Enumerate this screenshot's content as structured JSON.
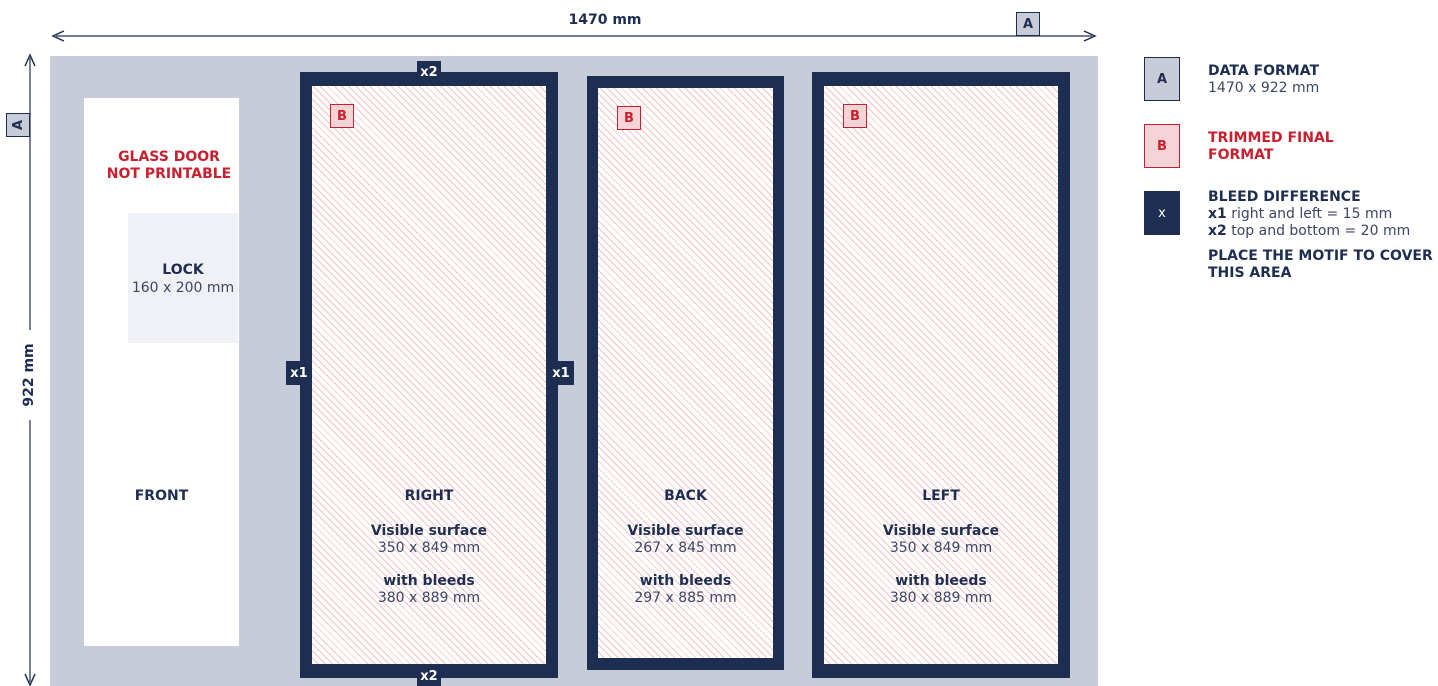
{
  "dimensions": {
    "width_label": "1470 mm",
    "height_label": "922 mm",
    "marker_letter": "A"
  },
  "front": {
    "glass_door_line1": "GLASS DOOR",
    "glass_door_line2": "NOT PRINTABLE",
    "lock_title": "LOCK",
    "lock_size": "160 x 200 mm",
    "label": "FRONT"
  },
  "bleed_markers": {
    "x1": "x1",
    "x2": "x2"
  },
  "panels": [
    {
      "badge": "B",
      "title": "RIGHT",
      "visible_label": "Visible surface",
      "visible_size": "350 x 849 mm",
      "bleeds_label": "with bleeds",
      "bleeds_size": "380 x 889 mm"
    },
    {
      "badge": "B",
      "title": "BACK",
      "visible_label": "Visible surface",
      "visible_size": "267 x 845 mm",
      "bleeds_label": "with bleeds",
      "bleeds_size": "297 x 885 mm"
    },
    {
      "badge": "B",
      "title": "LEFT",
      "visible_label": "Visible surface",
      "visible_size": "350 x 849 mm",
      "bleeds_label": "with bleeds",
      "bleeds_size": "380 x 889 mm"
    }
  ],
  "legend": {
    "data_format": {
      "swatch": "A",
      "title": "DATA FORMAT",
      "value": "1470 x 922 mm"
    },
    "trimmed": {
      "swatch": "B",
      "title_line1": "TRIMMED FINAL",
      "title_line2": "FORMAT"
    },
    "bleed": {
      "swatch": "x",
      "title": "BLEED DIFFERENCE",
      "x1_key": "x1",
      "x1_text": "right and left = 15 mm",
      "x2_key": "x2",
      "x2_text": "top and bottom = 20 mm"
    },
    "place_motif_line1": "PLACE THE MOTIF TO COVER",
    "place_motif_line2": "THIS AREA"
  },
  "colors": {
    "navy": "#1e2d52",
    "red": "#c8202e",
    "panel_bg": "#c8ccd9",
    "pink_hatch": "#f2c2c6"
  }
}
